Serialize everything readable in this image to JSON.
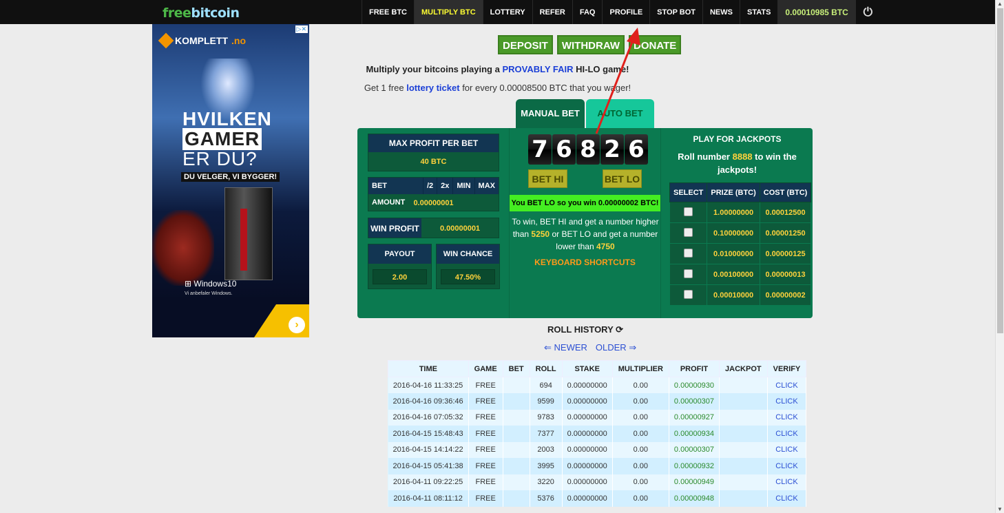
{
  "logo": {
    "part1": "free",
    "part2": "bitcoin"
  },
  "nav": [
    "FREE BTC",
    "MULTIPLY BTC",
    "LOTTERY",
    "REFER",
    "FAQ",
    "PROFILE",
    "STOP BOT",
    "NEWS",
    "STATS"
  ],
  "nav_active": "MULTIPLY BTC",
  "balance": "0.00010985 BTC",
  "ad": {
    "brand": "KOMPLETT",
    "brand_tld": ".no",
    "line1": "HVILKEN",
    "line2": "GAMER",
    "line3": "ER DU?",
    "tagline": "DU VELGER, VI BYGGER!",
    "os": "Windows10",
    "os_sub": "Vi anbefaler Windows."
  },
  "actions": {
    "deposit": "DEPOSIT",
    "withdraw": "WITHDRAW",
    "donate": "DONATE"
  },
  "intro": {
    "pre": "Multiply your bitcoins playing a",
    "link": "PROVABLY FAIR",
    "post": "HI-LO game!"
  },
  "lottery_note": {
    "pre": "Get 1 free",
    "link": "lottery ticket",
    "post": "for every 0.00008500 BTC that you wager!"
  },
  "tabs": {
    "manual": "MANUAL BET",
    "auto": "AUTO BET"
  },
  "max_profit": {
    "label": "MAX PROFIT PER BET",
    "value": "40 BTC"
  },
  "bet_amount": {
    "label": "BET AMOUNT",
    "half": "/2",
    "double": "2x",
    "min": "MIN",
    "max": "MAX",
    "value": "0.00000001"
  },
  "win_profit": {
    "label": "WIN PROFIT",
    "value": "0.00000001"
  },
  "payout": {
    "label": "PAYOUT",
    "value": "2.00"
  },
  "win_chance": {
    "label": "WIN CHANCE",
    "value": "47.50%"
  },
  "roll_digits": [
    "7",
    "6",
    "8",
    "2",
    "6"
  ],
  "bet_hi": "BET HI",
  "bet_lo": "BET LO",
  "result": "You BET LO so you win 0.00000002 BTC!",
  "rules": {
    "a": "To win, BET HI and get a number higher than",
    "hi": "5250",
    "b": "or BET LO and get a number lower than",
    "lo": "4750"
  },
  "shortcuts": "KEYBOARD SHORTCUTS",
  "jackpot": {
    "title": "PLAY FOR JACKPOTS",
    "pre": "Roll number",
    "num": "8888",
    "post": "to win the jackpots!",
    "headers": [
      "SELECT",
      "PRIZE (BTC)",
      "COST (BTC)"
    ],
    "rows": [
      [
        "1.00000000",
        "0.00012500"
      ],
      [
        "0.10000000",
        "0.00001250"
      ],
      [
        "0.01000000",
        "0.00000125"
      ],
      [
        "0.00100000",
        "0.00000013"
      ],
      [
        "0.00010000",
        "0.00000002"
      ]
    ]
  },
  "history": {
    "title": "ROLL HISTORY",
    "newer": "⇐ NEWER",
    "older": "OLDER ⇒",
    "headers": [
      "TIME",
      "GAME",
      "BET",
      "ROLL",
      "STAKE",
      "MULTIPLIER",
      "PROFIT",
      "JACKPOT",
      "VERIFY"
    ],
    "rows": [
      [
        "2016-04-16 11:33:25",
        "FREE",
        "",
        "694",
        "0.00000000",
        "0.00",
        "0.00000930",
        "",
        "CLICK"
      ],
      [
        "2016-04-16 09:36:46",
        "FREE",
        "",
        "9599",
        "0.00000000",
        "0.00",
        "0.00000307",
        "",
        "CLICK"
      ],
      [
        "2016-04-16 07:05:32",
        "FREE",
        "",
        "9783",
        "0.00000000",
        "0.00",
        "0.00000927",
        "",
        "CLICK"
      ],
      [
        "2016-04-15 15:48:43",
        "FREE",
        "",
        "7377",
        "0.00000000",
        "0.00",
        "0.00000934",
        "",
        "CLICK"
      ],
      [
        "2016-04-15 14:14:22",
        "FREE",
        "",
        "2003",
        "0.00000000",
        "0.00",
        "0.00000307",
        "",
        "CLICK"
      ],
      [
        "2016-04-15 05:41:38",
        "FREE",
        "",
        "3995",
        "0.00000000",
        "0.00",
        "0.00000932",
        "",
        "CLICK"
      ],
      [
        "2016-04-11 09:22:25",
        "FREE",
        "",
        "3220",
        "0.00000000",
        "0.00",
        "0.00000949",
        "",
        "CLICK"
      ],
      [
        "2016-04-11 08:11:12",
        "FREE",
        "",
        "5376",
        "0.00000000",
        "0.00",
        "0.00000948",
        "",
        "CLICK"
      ]
    ]
  },
  "colors": {
    "accent": "#ffff33",
    "game_bg": "#0b7a50",
    "button_green": "#4a9a28",
    "annotation_arrow": "#e0201c"
  }
}
